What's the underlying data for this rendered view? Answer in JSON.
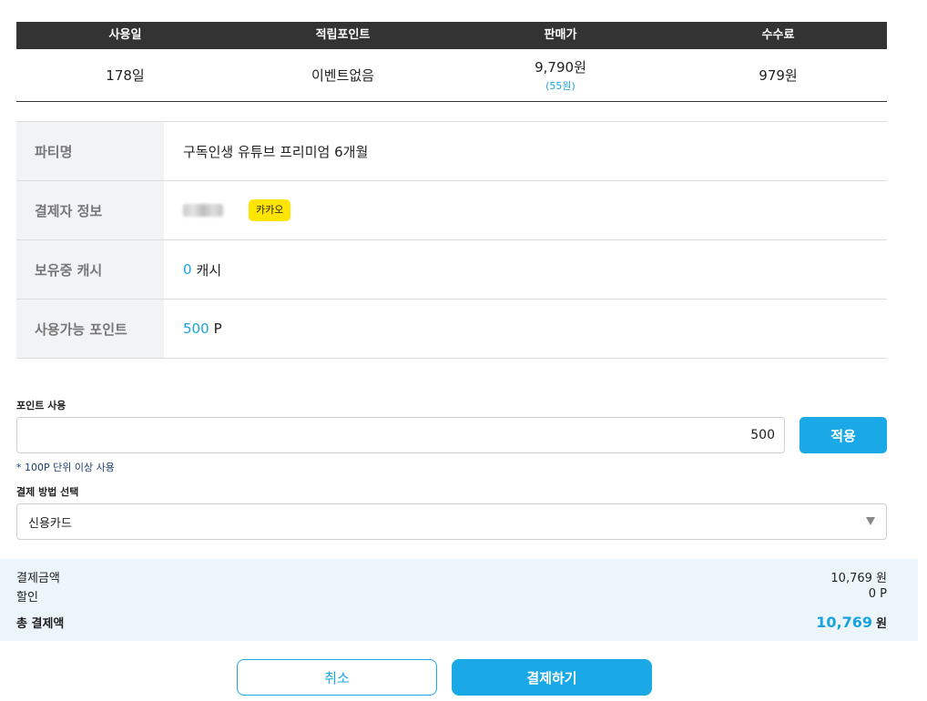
{
  "summary": {
    "headers": [
      "사용일",
      "적립포인트",
      "판매가",
      "수수료"
    ],
    "days": "178일",
    "points": "이벤트없음",
    "price": "9,790원",
    "price_sub": "(55원)",
    "fee": "979원"
  },
  "info": {
    "party_label": "파티명",
    "party_value": "구독인생 유튜브 프리미엄 6개월",
    "payer_label": "결제자 정보",
    "payer_badge": "카카오",
    "cash_label": "보유중 캐시",
    "cash_amount": "0",
    "cash_unit": "캐시",
    "points_label": "사용가능 포인트",
    "points_amount": "500",
    "points_unit": "P"
  },
  "points_use": {
    "label": "포인트 사용",
    "value": "500",
    "apply_label": "적용",
    "note": "* 100P 단위 이상 사용"
  },
  "payment": {
    "label": "결제 방법 선택",
    "selected": "신용카드"
  },
  "totals": {
    "amount_label": "결제금액",
    "amount_value": "10,769 원",
    "discount_label": "할인",
    "discount_value": "0 P",
    "total_label": "총 결제액",
    "total_value": "10,769",
    "total_unit": "원"
  },
  "buttons": {
    "cancel": "취소",
    "pay": "결제하기"
  },
  "colors": {
    "accent": "#1aa9e6",
    "header_bg": "#333333",
    "kakao": "#fee500",
    "totals_bg": "#ebf5fa"
  }
}
